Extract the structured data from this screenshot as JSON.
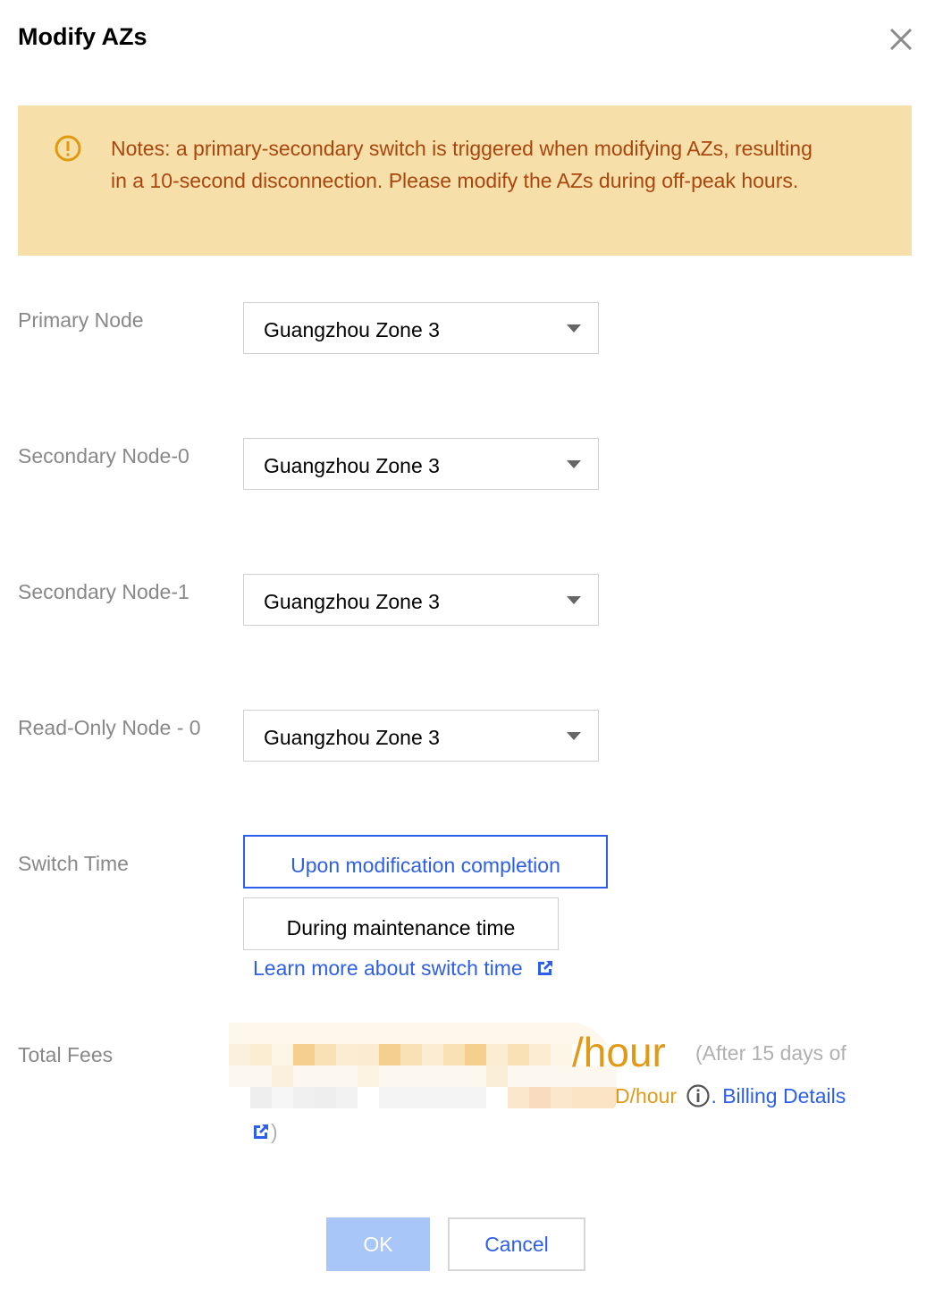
{
  "dialog": {
    "title": "Modify AZs",
    "close_icon": "close-icon"
  },
  "notice": {
    "icon": "warning-circle-icon",
    "color": "#a9460e",
    "background": "#f7dfaa",
    "text": "Notes: a primary-secondary switch is triggered when modifying AZs, resulting in a 10-second disconnection. Please modify the AZs during off-peak hours."
  },
  "fields": [
    {
      "label": "Primary Node",
      "value": "Guangzhou Zone 3"
    },
    {
      "label": "Secondary Node-0",
      "value": "Guangzhou Zone 3"
    },
    {
      "label": "Secondary Node-1",
      "value": "Guangzhou Zone 3"
    },
    {
      "label": "Read-Only Node - 0",
      "value": "Guangzhou Zone 3"
    }
  ],
  "switch_time": {
    "label": "Switch Time",
    "options": [
      "Upon modification completion",
      "During maintenance time"
    ],
    "selected": "Upon modification completion",
    "learn_more": "Learn more about switch time"
  },
  "fees": {
    "label": "Total Fees",
    "price_unit_visible": "/hour",
    "note_start": "(After 15 days of",
    "line2_unit_visible": "D/hour",
    "billing_details": "Billing Details",
    "close_paren": ")",
    "price_color": "#e19a18"
  },
  "buttons": {
    "ok": "OK",
    "cancel": "Cancel"
  },
  "colors": {
    "primary": "#2e5fe8",
    "label_gray": "#888888"
  }
}
